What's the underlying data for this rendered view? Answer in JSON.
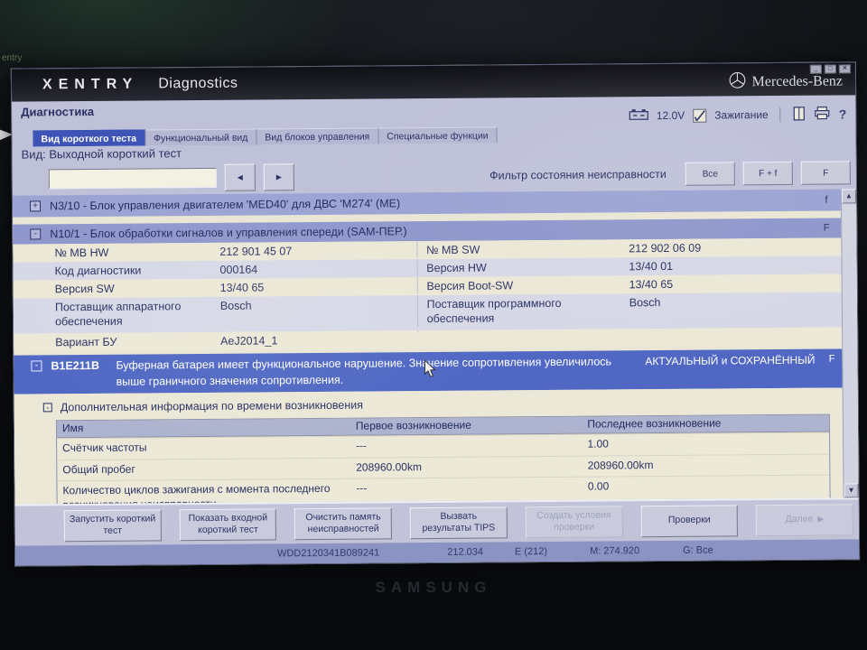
{
  "background": {
    "window_fragment": "entry",
    "device_brand": "SAMSUNG"
  },
  "titlebar": {
    "app": "XENTRY",
    "module": "Diagnostics",
    "brand": "Mercedes-Benz"
  },
  "header": {
    "title": "Диагностика",
    "battery_voltage": "12.0V",
    "ignition_label": "Зажигание"
  },
  "tabs": [
    {
      "label": "Вид короткого теста",
      "active": true
    },
    {
      "label": "Функциональный вид",
      "active": false
    },
    {
      "label": "Вид блоков управления",
      "active": false
    },
    {
      "label": "Специальные функции",
      "active": false
    }
  ],
  "view": {
    "label": "Вид: Выходной короткий тест"
  },
  "toolbar": {
    "search_value": "",
    "filter_label": "Фильтр состояния неисправности",
    "filters": [
      "Все",
      "F + f",
      "F"
    ]
  },
  "icons": {
    "prev": "◄",
    "next": "►",
    "up": "▲",
    "down": "▼",
    "help": "?",
    "minimize": "_",
    "maximize": "□",
    "close": "✕"
  },
  "modules": [
    {
      "expander": "+",
      "label": "N3/10 - Блок управления двигателем 'MED40' для ДВС 'M274' (ME)",
      "flag": "f"
    },
    {
      "expander": "-",
      "label": "N10/1 - Блок обработки сигналов и управления спереди (SAM-ПЕР.)",
      "flag": "F"
    }
  ],
  "ecu": {
    "rows": [
      {
        "l1": "№ MB HW",
        "v1": "212 901 45 07",
        "l2": "№ MB SW",
        "v2": "212 902 06 09"
      },
      {
        "l1": "Код диагностики",
        "v1": "000164",
        "l2": "Версия HW",
        "v2": "13/40 01"
      },
      {
        "l1": "Версия SW",
        "v1": "13/40 65",
        "l2": "Версия Boot-SW",
        "v2": "13/40 65"
      },
      {
        "l1": "Поставщик аппаратного обеспечения",
        "v1": "Bosch",
        "l2": "Поставщик программного обеспечения",
        "v2": "Bosch"
      },
      {
        "l1": "Вариант БУ",
        "v1": "AeJ2014_1",
        "l2": "",
        "v2": ""
      }
    ]
  },
  "fault": {
    "expander": "-",
    "code": "B1E211B",
    "message": "Буферная батарея имеет функциональное нарушение. Значение сопротивления увеличилось выше граничного значения сопротивления.",
    "status": "АКТУАЛЬНЫЙ и СОХРАНЁННЫЙ",
    "flag": "F"
  },
  "info": {
    "expander": "-",
    "title": "Дополнительная информация по времени возникновения",
    "columns": [
      "Имя",
      "Первое возникновение",
      "Последнее возникновение"
    ],
    "rows": [
      {
        "name": "Счётчик частоты",
        "first": "---",
        "last": "1.00"
      },
      {
        "name": "Общий пробег",
        "first": "208960.00km",
        "last": "208960.00km"
      },
      {
        "name": "Количество циклов зажигания с момента последнего возникновения неисправности",
        "first": "---",
        "last": "0.00"
      }
    ]
  },
  "footer": {
    "buttons": [
      {
        "label": "Запустить короткий тест"
      },
      {
        "label": "Показать входной короткий тест"
      },
      {
        "label": "Очистить память неисправностей"
      },
      {
        "label": "Вызвать результаты TIPS"
      },
      {
        "label": "Создать условия проверки"
      },
      {
        "label": "Проверки"
      },
      {
        "label": "Далее"
      }
    ],
    "next_arrow": "▶"
  },
  "status": {
    "vin": "WDD2120341B089241",
    "model": "212.034",
    "series": "E (212)",
    "engine": "M: 274.920",
    "gearbox": "G: Все"
  }
}
